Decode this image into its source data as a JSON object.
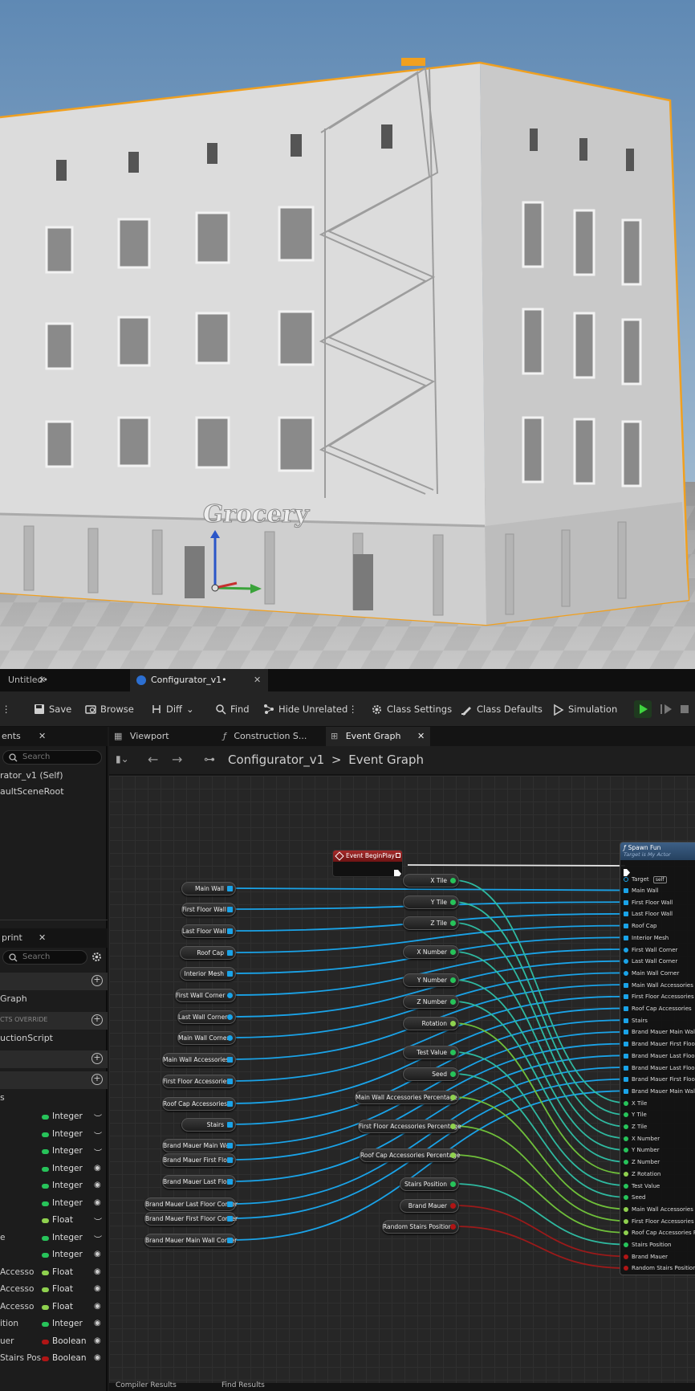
{
  "document_tabs": [
    {
      "label": "Untitled•",
      "active": false
    },
    {
      "label": "Configurator_v1•",
      "active": true
    }
  ],
  "toolbar": {
    "save": "Save",
    "browse": "Browse",
    "diff": "Diff",
    "find": "Find",
    "hide_unrelated": "Hide Unrelated",
    "class_settings": "Class Settings",
    "class_defaults": "Class Defaults",
    "simulation": "Simulation"
  },
  "components_panel": {
    "tab": "ents",
    "search_placeholder": "Search",
    "items": [
      "rator_v1 (Self)",
      "aultSceneRoot"
    ]
  },
  "my_blueprint": {
    "tab": "print",
    "search_placeholder": "Search",
    "entries": [
      "Graph",
      "CTS OVERRIDE",
      "uctionScript"
    ],
    "variables_label": "s",
    "variables": [
      {
        "name": "",
        "type": "Integer",
        "color": "#27c35a",
        "vis": "hidden"
      },
      {
        "name": "",
        "type": "Integer",
        "color": "#27c35a",
        "vis": "hidden"
      },
      {
        "name": "",
        "type": "Integer",
        "color": "#27c35a",
        "vis": "hidden"
      },
      {
        "name": "",
        "type": "Integer",
        "color": "#27c35a",
        "vis": "visible"
      },
      {
        "name": "",
        "type": "Integer",
        "color": "#27c35a",
        "vis": "visible"
      },
      {
        "name": "",
        "type": "Integer",
        "color": "#27c35a",
        "vis": "visible"
      },
      {
        "name": "",
        "type": "Float",
        "color": "#8fd14f",
        "vis": "hidden"
      },
      {
        "name": "e",
        "type": "Integer",
        "color": "#27c35a",
        "vis": "hidden"
      },
      {
        "name": "",
        "type": "Integer",
        "color": "#27c35a",
        "vis": "visible"
      },
      {
        "name": "Accesso",
        "type": "Float",
        "color": "#8fd14f",
        "vis": "visible"
      },
      {
        "name": "Accesso",
        "type": "Float",
        "color": "#8fd14f",
        "vis": "visible"
      },
      {
        "name": "Accesso",
        "type": "Float",
        "color": "#8fd14f",
        "vis": "visible"
      },
      {
        "name": "ition",
        "type": "Integer",
        "color": "#27c35a",
        "vis": "visible"
      },
      {
        "name": "uer",
        "type": "Boolean",
        "color": "#b01515",
        "vis": "visible"
      },
      {
        "name": "Stairs Pos",
        "type": "Boolean",
        "color": "#b01515",
        "vis": "visible"
      }
    ]
  },
  "graph_tabs": [
    {
      "label": "Viewport",
      "active": false
    },
    {
      "label": "Construction S...",
      "active": false
    },
    {
      "label": "Event Graph",
      "active": true
    }
  ],
  "breadcrumb": {
    "root": "Configurator_v1",
    "sep": ">",
    "current": "Event Graph"
  },
  "event_node": {
    "title": "Event BeginPlay"
  },
  "spawn_node": {
    "title": "Spawn Fun",
    "subtitle": "Target is My Actor",
    "target_label": "Target",
    "target_value": "self",
    "pins": [
      "Main Wall",
      "First Floor Wall",
      "Last Floor Wall",
      "Roof Cap",
      "Interior Mesh",
      "First Wall Corner",
      "Last Wall Corner",
      "Main Wall Corner",
      "Main Wall Accessories",
      "First Floor Accessories",
      "Roof Cap Accessories",
      "Stairs",
      "Brand Mauer Main Wall",
      "Brand Mauer First Floor",
      "Brand Mauer Last Floor",
      "Brand Mauer Last Floor Co",
      "Brand Mauer First Floor Co",
      "Brand Mauer Main Wall Co",
      "X Tile",
      "Y Tile",
      "Z Tile",
      "X Number",
      "Y Number",
      "Z Number",
      "Z Rotation",
      "Test Value",
      "Seed",
      "Main Wall Accessories Per",
      "First Floor Accessories Per",
      "Roof Cap Accessories Per",
      "Stairs Position",
      "Brand Mauer",
      "Random Stairs Position"
    ]
  },
  "left_var_nodes": [
    "Main Wall",
    "First Floor Wall",
    "Last Floor Wall",
    "Roof Cap",
    "Interior Mesh",
    "First Wall Corner",
    "Last Wall Corner",
    "Main Wall Corner",
    "Main Wall Accessories",
    "First Floor Accessories",
    "Roof Cap Accessories",
    "Stairs",
    "Brand Mauer Main Wall",
    "Brand Mauer First Floor",
    "Brand Mauer Last Floor",
    "Brand Mauer Last Floor Corner",
    "Brand Mauer First Floor Corner",
    "Brand Mauer Main Wall Corner"
  ],
  "mid_var_nodes": [
    "X Tile",
    "Y Tile",
    "Z Tile",
    "X Number",
    "Y Number",
    "Z Number",
    "Rotation",
    "Test Value",
    "Seed",
    "Main Wall Accessories Percentage",
    "First Floor Accessories Percentage",
    "Roof Cap Accessories Percentage",
    "Stairs Position",
    "Brand Mauer",
    "Random Stairs Position"
  ],
  "bottom_tabs": [
    "Compiler Results",
    "Find Results"
  ],
  "scene": {
    "sign_text": "Grocery"
  },
  "colors": {
    "object_pin": "#1aa3e8",
    "integer_pin": "#27c35a",
    "float_pin": "#8fd14f",
    "bool_pin": "#b01515",
    "selection": "#f0a020"
  }
}
